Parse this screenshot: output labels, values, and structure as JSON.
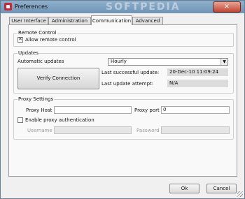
{
  "window": {
    "title": "Preferences",
    "watermark": "SOFTPEDIA",
    "close_glyph": "✕"
  },
  "tabs": [
    {
      "label": "User Interface"
    },
    {
      "label": "Administration"
    },
    {
      "label": "Communication"
    },
    {
      "label": "Advanced"
    }
  ],
  "active_tab": "Communication",
  "remote_control": {
    "title": "Remote Control",
    "allow_label": "Allow remote control",
    "allow_checked": true
  },
  "updates": {
    "title": "Updates",
    "automatic_label": "Automatic updates",
    "automatic_value": "Hourly",
    "verify_label": "Verify Connection",
    "last_success_label": "Last successful update:",
    "last_success_value": "20-Dec-10 11:09:24",
    "last_attempt_label": "Last update attempt:",
    "last_attempt_value": "N/A"
  },
  "proxy": {
    "title": "Proxy Settings",
    "host_label": "Proxy Host",
    "host_value": "",
    "port_label": "Proxy port",
    "port_value": "0",
    "auth_label": "Enable proxy authentication",
    "auth_checked": false,
    "username_label": "Username",
    "username_value": "",
    "password_label": "Password",
    "password_value": ""
  },
  "buttons": {
    "ok": "Ok",
    "cancel": "Cancel"
  }
}
